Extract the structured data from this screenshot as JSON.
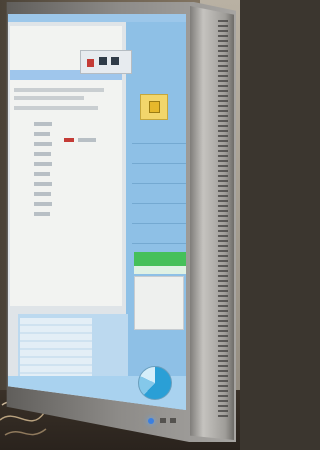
{
  "scene": {
    "description": "",
    "colors": {
      "screen_blue": "#8ec0e6",
      "screen_panel": "#f2f3f1",
      "toolbar_red": "#c43b36",
      "status_yellow": "#f2d66b",
      "status_green": "#45c05a",
      "pie_main": "#2a9fd6",
      "power_led": "#3b7fe0"
    }
  },
  "monitor": {
    "type": "computer monitor",
    "screen_content": "application UI",
    "icons": [
      "table-icon",
      "pie-chart-icon",
      "toolbar-icon",
      "status-icon"
    ]
  }
}
